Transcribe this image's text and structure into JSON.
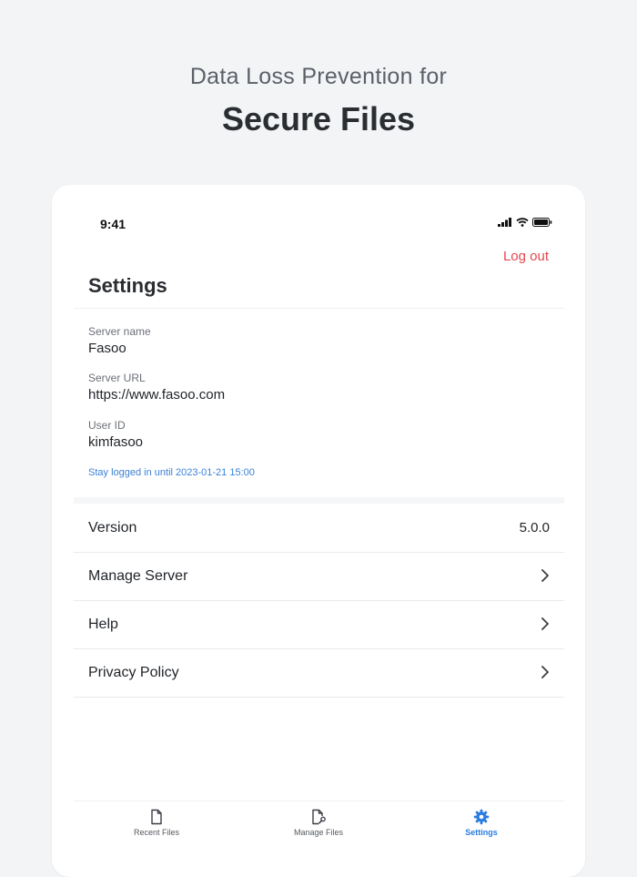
{
  "headline": {
    "line1": "Data Loss Prevention for",
    "line2": "Secure Files"
  },
  "status_bar": {
    "time": "9:41",
    "icons": [
      "signal-icon",
      "wifi-icon",
      "battery-icon"
    ]
  },
  "header": {
    "logout_label": "Log out",
    "title": "Settings"
  },
  "account": {
    "server_name_label": "Server name",
    "server_name": "Fasoo",
    "server_url_label": "Server URL",
    "server_url": "https://www.fasoo.com",
    "user_id_label": "User ID",
    "user_id": "kimfasoo",
    "stay_logged_text": "Stay logged in until 2023-01-21 15:00"
  },
  "menu": {
    "version_label": "Version",
    "version_value": "5.0.0",
    "manage_server_label": "Manage Server",
    "help_label": "Help",
    "privacy_label": "Privacy Policy"
  },
  "tabbar": {
    "tabs": [
      {
        "label": "Recent Files",
        "icon": "file-icon"
      },
      {
        "label": "Manage Files",
        "icon": "file-wrench-icon"
      },
      {
        "label": "Settings",
        "icon": "gear-icon",
        "active": true
      }
    ]
  },
  "colors": {
    "accent": "#2b7de0",
    "danger": "#e5484d",
    "background": "#f3f4f6"
  }
}
